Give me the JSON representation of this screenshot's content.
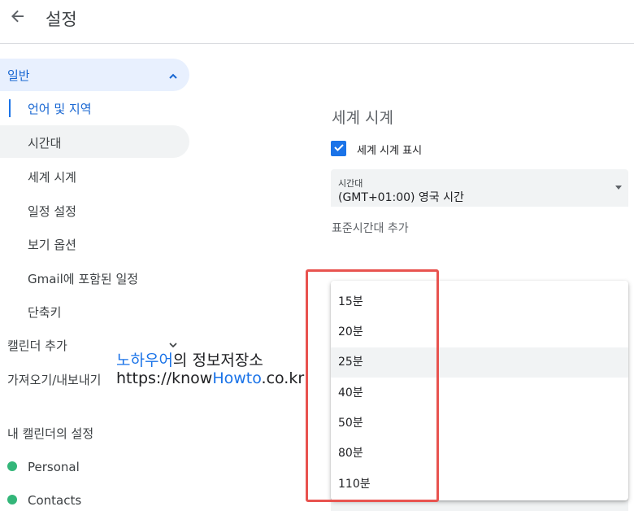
{
  "header": {
    "title": "설정",
    "back_icon": "arrow-left-icon"
  },
  "sidebar": {
    "general": {
      "label": "일반",
      "icon": "chevron-up-icon"
    },
    "items": [
      {
        "label": "언어 및 지역"
      },
      {
        "label": "시간대"
      },
      {
        "label": "세계 시계"
      },
      {
        "label": "일정 설정"
      },
      {
        "label": "보기 옵션"
      },
      {
        "label": "Gmail에 포함된 일정"
      },
      {
        "label": "단축키"
      }
    ],
    "add_calendar": {
      "label": "캘린더 추가",
      "icon": "chevron-down-icon"
    },
    "import_export": {
      "label": "가져오기/내보내기"
    },
    "my_calendars_title": "내 캘린더의 설정",
    "calendars": [
      {
        "label": "Personal",
        "color": "#33b679"
      },
      {
        "label": "Contacts",
        "color": "#33b679"
      }
    ]
  },
  "watermark": {
    "line1_highlight": "노하우어",
    "line1_rest": "의 정보저장소",
    "line2_prefix": "https://know",
    "line2_highlight": "Howto",
    "line2_suffix": ".co.kr"
  },
  "world_clock": {
    "title": "세계 시계",
    "checkbox_label": "세계 시계 표시",
    "checked": true,
    "timezone_small_label": "시간대",
    "timezone_value": "(GMT+01:00) 영국 시간",
    "add_timezone_label": "표준시간대 추가"
  },
  "dropdown": {
    "options": [
      "15분",
      "20분",
      "25분",
      "40분",
      "50분",
      "80분",
      "110분"
    ],
    "selected": "25분"
  },
  "colors": {
    "accent": "#1a73e8",
    "highlight_box": "#e8534f",
    "calendar_dot": "#33b679"
  }
}
